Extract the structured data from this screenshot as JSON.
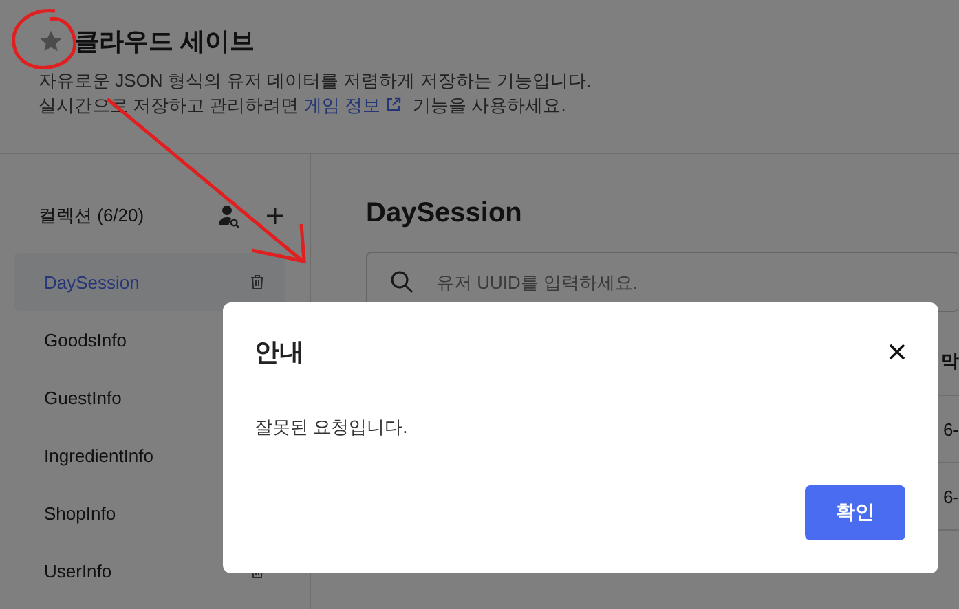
{
  "header": {
    "title": "클라우드 세이브",
    "description": [
      {
        "kind": "text",
        "text": "자유로운 JSON 형식의 유저 데이터를 저렴하게 저장하는 기능입니다."
      },
      {
        "kind": "link",
        "before": "실시간으로 저장하고 관리하려면 ",
        "link": "게임 정보",
        "after": " 기능을 사용하세요."
      }
    ]
  },
  "sidebar": {
    "heading": "컬렉션 (6/20)",
    "items": [
      {
        "label": "DaySession",
        "selected": true,
        "trash": true
      },
      {
        "label": "GoodsInfo",
        "selected": false,
        "trash": false
      },
      {
        "label": "GuestInfo",
        "selected": false,
        "trash": false
      },
      {
        "label": "IngredientInfo",
        "selected": false,
        "trash": false
      },
      {
        "label": "ShopInfo",
        "selected": false,
        "trash": false
      },
      {
        "label": "UserInfo",
        "selected": false,
        "trash": true
      }
    ]
  },
  "main": {
    "title": "DaySession",
    "search": {
      "placeholder": "유저 UUID를 입력하세요."
    },
    "table": {
      "columns": [
        "막"
      ],
      "rows": [
        [
          "6-"
        ],
        [
          "6-"
        ]
      ]
    }
  },
  "dialog": {
    "title": "안내",
    "message": "잘못된 요청입니다.",
    "buttons": [
      "확인"
    ]
  }
}
